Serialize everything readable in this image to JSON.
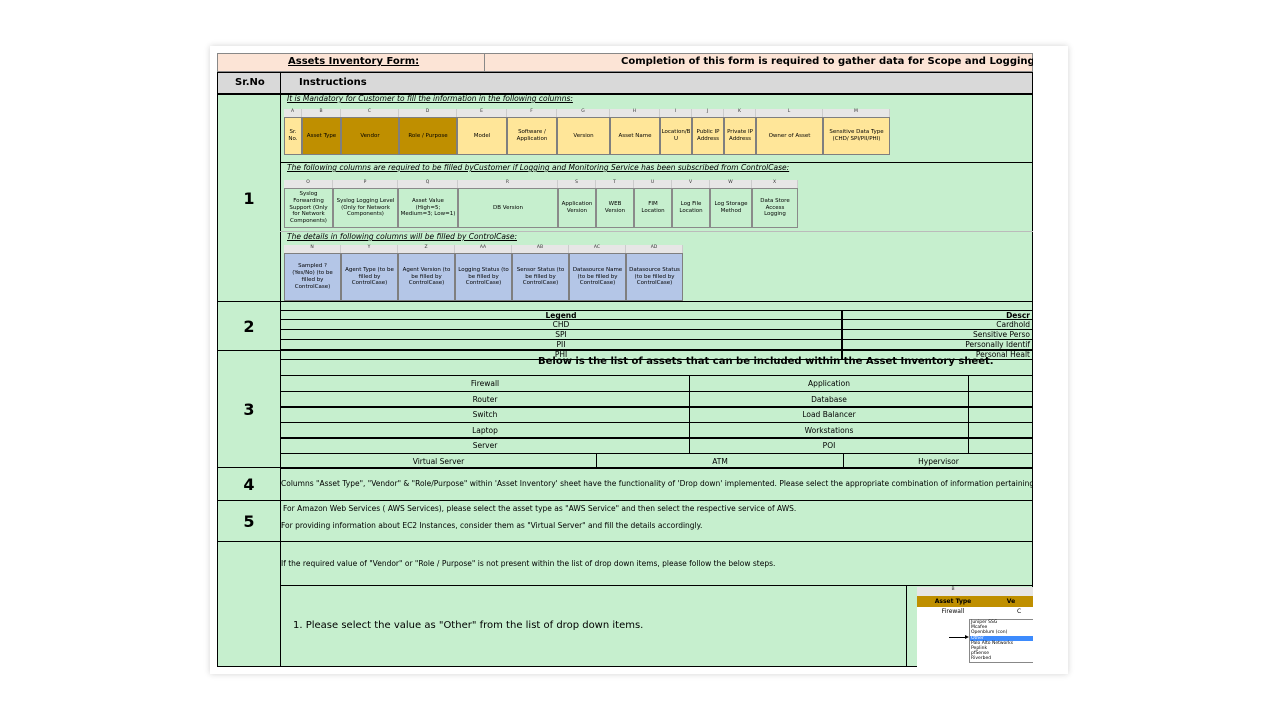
{
  "header": {
    "title": "Assets Inventory Form:",
    "subtitle": "Completion of this form is required to gather data for Scope and Logging & M"
  },
  "columns": {
    "srno": "Sr.No",
    "instructions": "Instructions"
  },
  "rows": [
    {
      "no": "1"
    },
    {
      "no": "2"
    },
    {
      "no": "3"
    },
    {
      "no": "4"
    },
    {
      "no": "5"
    }
  ],
  "section1": {
    "mandatory_note": "It is Mandatory for Customer to fill the information in the following columns:",
    "mandatory_letters": [
      "A",
      "B",
      "C",
      "D",
      "E",
      "F",
      "G",
      "H",
      "I",
      "J",
      "K",
      "L",
      "M"
    ],
    "mandatory_cols": [
      "Sr. No.",
      "Asset Type",
      "Vendor",
      "Role / Purpose",
      "Model",
      "Software / Application",
      "Version",
      "Asset Name",
      "Location/B U",
      "Public IP Address",
      "Private IP Address",
      "Owner of Asset",
      "Sensitive Data Type (CHD/ SPI/PII/PHI)"
    ],
    "logging_note": "The following columns are required to be filled byCustomer if Logging and Monitoring Service has been subscribed from ControlCase:",
    "logging_letters": [
      "O",
      "P",
      "Q",
      "R",
      "S",
      "T",
      "U",
      "V",
      "W",
      "X"
    ],
    "logging_cols": [
      "Syslog Forwarding Support (Only for Network Components)",
      "Syslog Logging Level (Only for Network Components)",
      "Asset Value (High=5; Medium=3; Low=1)",
      "DB Version",
      "Application Version",
      "WEB Version",
      "FIM Location",
      "Log File Location",
      "Log Storage Method",
      "Data Store Access Logging"
    ],
    "controlcase_note": "The details in following columns will be filled by ControlCase:",
    "controlcase_letters": [
      "N",
      "Y",
      "Z",
      "AA",
      "AB",
      "AC",
      "AD"
    ],
    "controlcase_cols": [
      "Sampled ? (Yes/No) (to be filled by ControlCase)",
      "Agent Type (to be filled by ControlCase)",
      "Agent Version (to be filled by ControlCase)",
      "Logging Status (to be filled by ControlCase)",
      "Sensor Status (to be filled by ControlCase)",
      "Datasource Name (to be filled by ControlCase)",
      "Datasource Status (to be filled by ControlCase)"
    ]
  },
  "section2": {
    "legend_header": "Legend",
    "desc_header": "Descr",
    "items": [
      {
        "legend": "CHD",
        "desc": "Cardhold"
      },
      {
        "legend": "SPI",
        "desc": "Sensitive Perso"
      },
      {
        "legend": "PII",
        "desc": "Personally Identif"
      },
      {
        "legend": "PHI",
        "desc": "Personal Healt"
      }
    ]
  },
  "section3": {
    "title": "Below is the list of assets that can be included within the Asset Inventory sheet.",
    "grid": [
      [
        "Firewall",
        "Application"
      ],
      [
        "Router",
        "Database"
      ],
      [
        "Switch",
        "Load Balancer"
      ],
      [
        "Laptop",
        "Workstations"
      ],
      [
        "Server",
        "POI"
      ]
    ],
    "last_row": [
      "Virtual Server",
      "ATM",
      "Hypervisor"
    ]
  },
  "section4": {
    "text": "Columns \"Asset Type\", \"Vendor\" & \"Role/Purpose\" within  'Asset Inventory' sheet have the functionality of  'Drop down' implemented. Please select the appropriate combination of information pertaining to the ass"
  },
  "section5": {
    "line1": "For Amazon Web Services ( AWS Services), please select the asset type as \"AWS Service\" and then select the respective service of AWS.",
    "line2": "For providing information about EC2 Instances, consider them as \"Virtual Server\" and fill the details accordingly."
  },
  "section6": {
    "intro": "If the required value of \"Vendor\" or \"Role / Purpose\" is not present within the list of drop down items, please follow the below steps.",
    "step1": "1. Please select the value as \"Other\" from the list of drop down items.",
    "thumb": {
      "col_letter": "B",
      "header": "Asset Type",
      "header2": "Ve",
      "value": "Firewall",
      "value2": "C",
      "options": [
        "Juniper SSG",
        "Mcafee",
        "Openblum (con)",
        "Other",
        "Palo Alto Networks",
        "Peplink",
        "pfSense",
        "Riverbed"
      ]
    }
  }
}
